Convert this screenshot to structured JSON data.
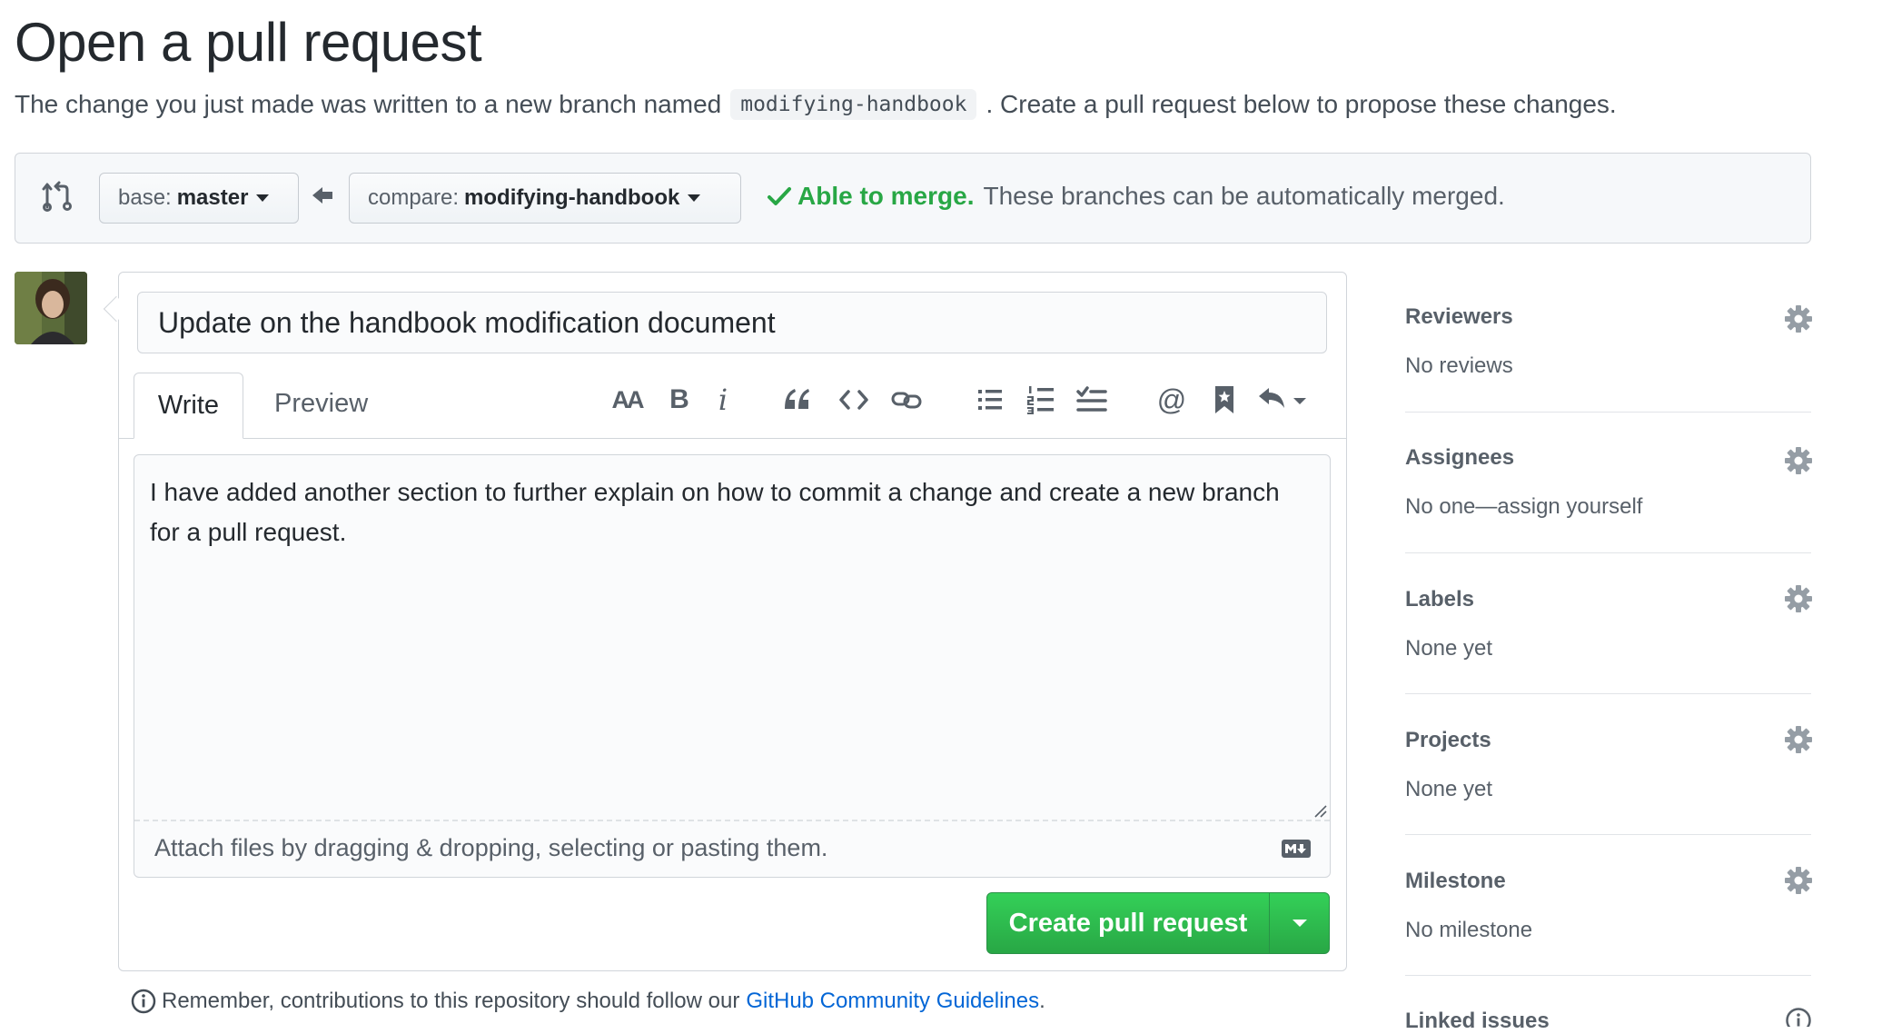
{
  "page": {
    "title": "Open a pull request",
    "subtitle_before": "The change you just made was written to a new branch named",
    "branch_name": "modifying-handbook",
    "subtitle_after": ". Create a pull request below to propose these changes."
  },
  "compare": {
    "base_prefix": "base:",
    "base_branch": "master",
    "compare_prefix": "compare:",
    "compare_branch": "modifying-handbook",
    "merge_status": "Able to merge.",
    "merge_message": "These branches can be automatically merged."
  },
  "form": {
    "title_value": "Update on the handbook modification document",
    "tabs": {
      "write": "Write",
      "preview": "Preview"
    },
    "toolbar": [
      "header-icon",
      "bold-icon",
      "italic-icon",
      "quote-icon",
      "code-icon",
      "link-icon",
      "unordered-list-icon",
      "ordered-list-icon",
      "task-list-icon",
      "mention-icon",
      "reference-icon",
      "reply-icon"
    ],
    "toolbar_text": {
      "header": "AA",
      "bold": "B",
      "italic": "i",
      "mention": "@"
    },
    "body_text": "I have added another section to further explain on how to commit a change and create a new branch for a pull request.",
    "attach_text": "Attach files by dragging & dropping, selecting or pasting them.",
    "submit_label": "Create pull request",
    "remember_text": "Remember, contributions to this repository should follow our",
    "guidelines_link": "GitHub Community Guidelines",
    "remember_end": "."
  },
  "sidebar": {
    "reviewers": {
      "title": "Reviewers",
      "value": "No reviews"
    },
    "assignees": {
      "title": "Assignees",
      "value": "No one—assign yourself"
    },
    "labels": {
      "title": "Labels",
      "value": "None yet"
    },
    "projects": {
      "title": "Projects",
      "value": "None yet"
    },
    "milestone": {
      "title": "Milestone",
      "value": "No milestone"
    },
    "linked_issues": {
      "title": "Linked issues"
    }
  },
  "colors": {
    "accent_green": "#28a745",
    "link_blue": "#0366d6",
    "muted_text": "#586069"
  }
}
